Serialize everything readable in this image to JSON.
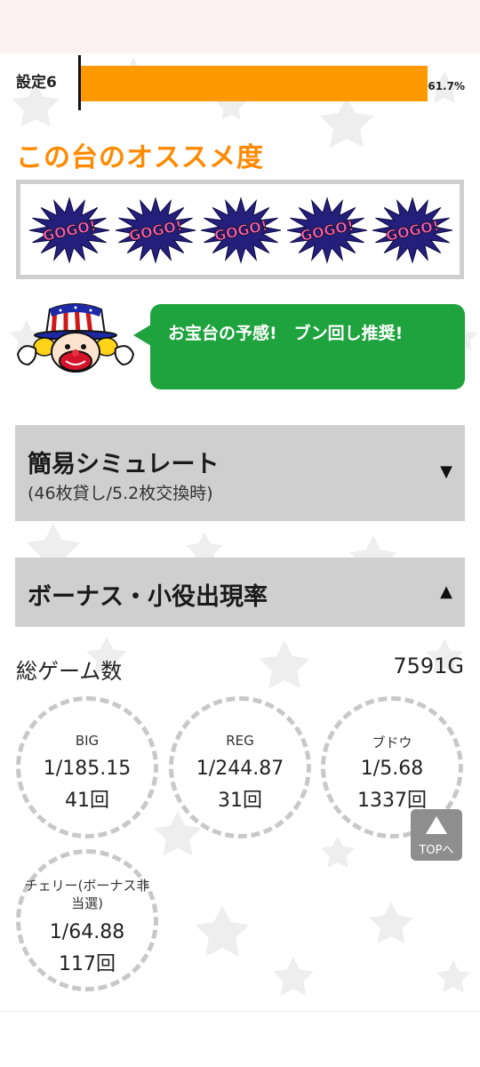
{
  "setting": {
    "label": "設定6",
    "value_text": "61.7%",
    "fill_fraction": 0.98,
    "bar_color": "#ff9900"
  },
  "recommend": {
    "title": "この台のオススメ度",
    "badges": [
      "GOGO!",
      "GOGO!",
      "GOGO!",
      "GOGO!",
      "GOGO!"
    ],
    "message": "お宝台の予感!　ブン回し推奨!"
  },
  "simulate": {
    "title": "簡易シミュレート",
    "subtitle": "(46枚貸し/5.2枚交換時)",
    "arrow": "▼"
  },
  "bonus": {
    "title": "ボーナス・小役出現率",
    "arrow": "▲",
    "games_label": "総ゲーム数",
    "games_value": "7591G",
    "items": [
      {
        "name": "BIG",
        "rate": "1/185.15",
        "count": "41回"
      },
      {
        "name": "REG",
        "rate": "1/244.87",
        "count": "31回"
      },
      {
        "name": "ブドウ",
        "rate": "1/5.68",
        "count": "1337回"
      },
      {
        "name": "チェリー(ボーナス非当選)",
        "rate": "1/64.88",
        "count": "117回"
      }
    ]
  },
  "top_button": {
    "label": "TOPへ",
    "icon": "up-triangle-icon"
  },
  "colors": {
    "accent_orange": "#ff8a00",
    "bubble_green": "#1fa33f",
    "accordion_gray": "#cfcfcf"
  }
}
